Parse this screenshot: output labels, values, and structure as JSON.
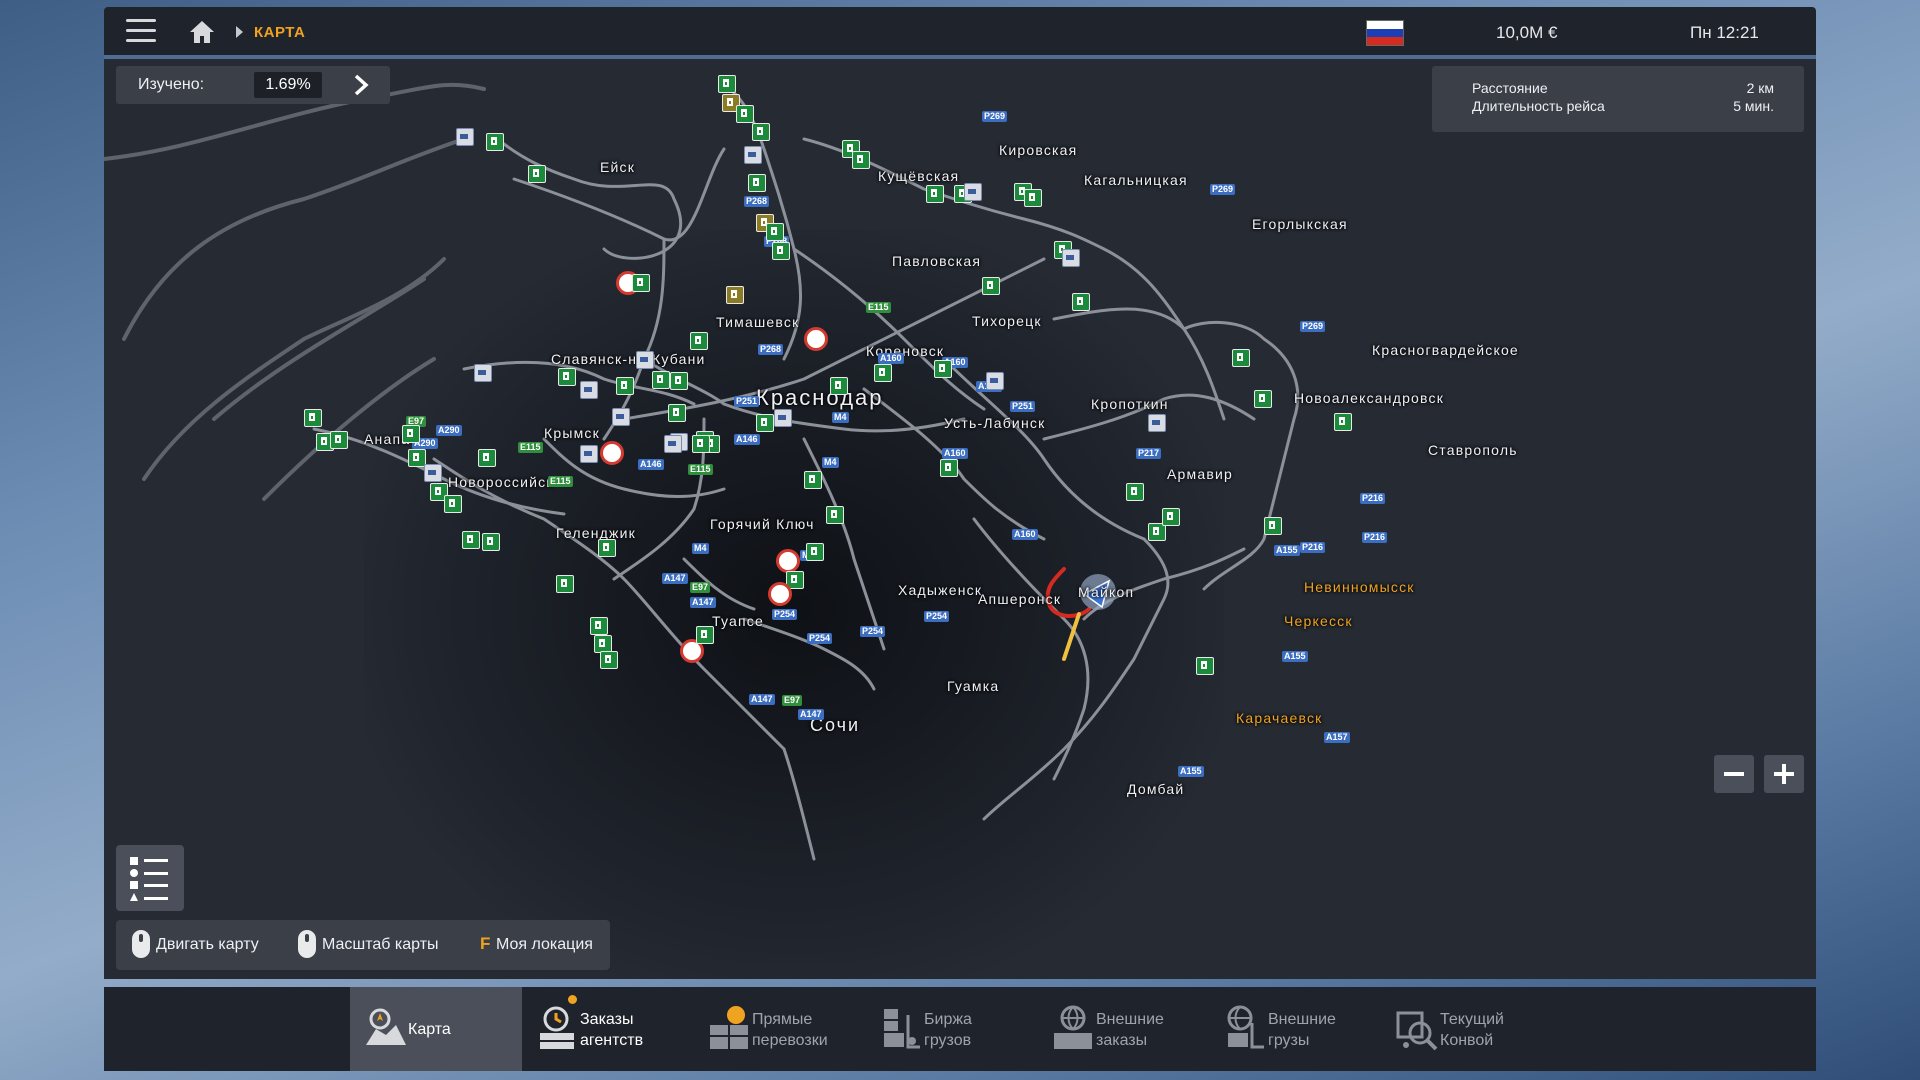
{
  "header": {
    "breadcrumb": "КАРТА",
    "money": "10,0M  €",
    "clock": "Пн 12:21",
    "flag_colors": [
      "#ffffff",
      "#1c3fb5",
      "#d52b1e"
    ]
  },
  "explored": {
    "label": "Изучено:",
    "value": "1.69%"
  },
  "route_info": {
    "distance_label": "Расстояние",
    "distance_value": "2 км",
    "duration_label": "Длительность рейса",
    "duration_value": "5 мин."
  },
  "map": {
    "cities": {
      "eysk": "Ейск",
      "kushchevskaya": "Кущёвская",
      "kirovskaya": "Кировская",
      "kagalnitskaya": "Кагальницкая",
      "egorlykskaya": "Егорлыкская",
      "pavlovskaya": "Павловская",
      "timashevsk": "Тимашевск",
      "tikhoretsk": "Тихорецк",
      "korenovsk": "Кореновск",
      "slavyansk": "Славянск-на-Кубани",
      "krasnodar": "Краснодар",
      "krasnogvardeyskoe": "Красногвардейское",
      "novoaleksandrovsk": "Новоалександровск",
      "kropotkin": "Кропоткин",
      "ust_labinsk": "Усть-Лабинск",
      "krymsk": "Крымск",
      "anapa": "Анапа",
      "novorossiysk": "Новороссийск",
      "stavropol": "Ставрополь",
      "armavir": "Армавир",
      "gelendzhik": "Геленджик",
      "goryachiy_klyuch": "Горячий Ключ",
      "nevinnomyssk": "Невинномысск",
      "cherkessk": "Черкесск",
      "khadyzhensk": "Хадыженск",
      "apsheronsk": "Апшеронск",
      "maykop": "Майкоп",
      "tuapse": "Туапсе",
      "guamka": "Гуамка",
      "karachaevsk": "Карачаевск",
      "sochi": "Сочи",
      "dombay": "Домбай"
    },
    "road_labels": [
      "P269",
      "P268",
      "P268",
      "E115",
      "P268",
      "A160",
      "A160",
      "A160",
      "P251",
      "M4",
      "A146",
      "A146",
      "E115",
      "M4",
      "A290",
      "E97",
      "A290",
      "E115",
      "E115",
      "A160",
      "P217",
      "P216",
      "P216",
      "A155",
      "P216",
      "P269",
      "P269",
      "M4",
      "A147",
      "E97",
      "A147",
      "P254",
      "P254",
      "P254",
      "P254",
      "A147",
      "E97",
      "A147",
      "A155",
      "A157",
      "A155",
      "M4",
      "A160",
      "P251"
    ]
  },
  "controls": {
    "move_map": "Двигать карту",
    "zoom_map": "Масштаб карты",
    "my_location_key": "F",
    "my_location": "Моя локация"
  },
  "tabs": [
    {
      "label": "Карта",
      "icon": "map-icon"
    },
    {
      "label": "Заказы\nагентств",
      "icon": "agency-orders-icon"
    },
    {
      "label": "Прямые\nперевозки",
      "icon": "direct-transport-icon"
    },
    {
      "label": "Биржа\nгрузов",
      "icon": "freight-market-icon"
    },
    {
      "label": "Внешние\nзаказы",
      "icon": "external-orders-icon"
    },
    {
      "label": "Внешние\nгрузы",
      "icon": "external-cargo-icon"
    },
    {
      "label": "Текущий\nКонвой",
      "icon": "convoy-icon"
    }
  ],
  "accent_color": "#f0a320"
}
